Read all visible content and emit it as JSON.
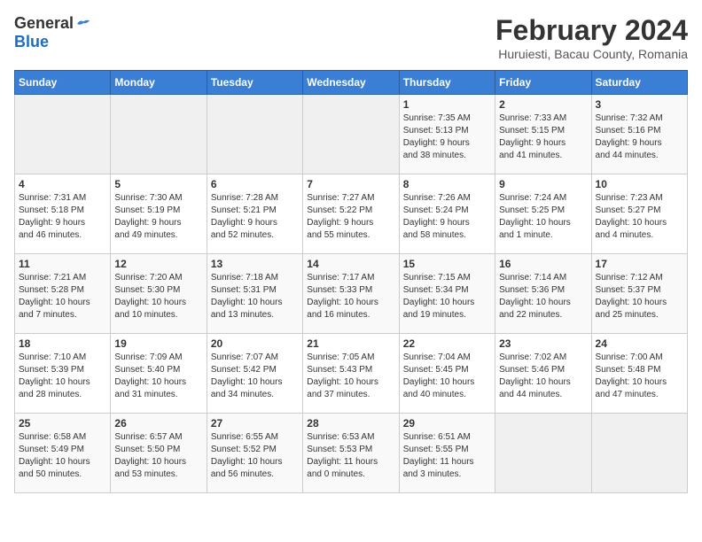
{
  "header": {
    "logo_general": "General",
    "logo_blue": "Blue",
    "title": "February 2024",
    "subtitle": "Huruiesti, Bacau County, Romania"
  },
  "weekdays": [
    "Sunday",
    "Monday",
    "Tuesday",
    "Wednesday",
    "Thursday",
    "Friday",
    "Saturday"
  ],
  "weeks": [
    [
      {
        "day": "",
        "info": ""
      },
      {
        "day": "",
        "info": ""
      },
      {
        "day": "",
        "info": ""
      },
      {
        "day": "",
        "info": ""
      },
      {
        "day": "1",
        "info": "Sunrise: 7:35 AM\nSunset: 5:13 PM\nDaylight: 9 hours\nand 38 minutes."
      },
      {
        "day": "2",
        "info": "Sunrise: 7:33 AM\nSunset: 5:15 PM\nDaylight: 9 hours\nand 41 minutes."
      },
      {
        "day": "3",
        "info": "Sunrise: 7:32 AM\nSunset: 5:16 PM\nDaylight: 9 hours\nand 44 minutes."
      }
    ],
    [
      {
        "day": "4",
        "info": "Sunrise: 7:31 AM\nSunset: 5:18 PM\nDaylight: 9 hours\nand 46 minutes."
      },
      {
        "day": "5",
        "info": "Sunrise: 7:30 AM\nSunset: 5:19 PM\nDaylight: 9 hours\nand 49 minutes."
      },
      {
        "day": "6",
        "info": "Sunrise: 7:28 AM\nSunset: 5:21 PM\nDaylight: 9 hours\nand 52 minutes."
      },
      {
        "day": "7",
        "info": "Sunrise: 7:27 AM\nSunset: 5:22 PM\nDaylight: 9 hours\nand 55 minutes."
      },
      {
        "day": "8",
        "info": "Sunrise: 7:26 AM\nSunset: 5:24 PM\nDaylight: 9 hours\nand 58 minutes."
      },
      {
        "day": "9",
        "info": "Sunrise: 7:24 AM\nSunset: 5:25 PM\nDaylight: 10 hours\nand 1 minute."
      },
      {
        "day": "10",
        "info": "Sunrise: 7:23 AM\nSunset: 5:27 PM\nDaylight: 10 hours\nand 4 minutes."
      }
    ],
    [
      {
        "day": "11",
        "info": "Sunrise: 7:21 AM\nSunset: 5:28 PM\nDaylight: 10 hours\nand 7 minutes."
      },
      {
        "day": "12",
        "info": "Sunrise: 7:20 AM\nSunset: 5:30 PM\nDaylight: 10 hours\nand 10 minutes."
      },
      {
        "day": "13",
        "info": "Sunrise: 7:18 AM\nSunset: 5:31 PM\nDaylight: 10 hours\nand 13 minutes."
      },
      {
        "day": "14",
        "info": "Sunrise: 7:17 AM\nSunset: 5:33 PM\nDaylight: 10 hours\nand 16 minutes."
      },
      {
        "day": "15",
        "info": "Sunrise: 7:15 AM\nSunset: 5:34 PM\nDaylight: 10 hours\nand 19 minutes."
      },
      {
        "day": "16",
        "info": "Sunrise: 7:14 AM\nSunset: 5:36 PM\nDaylight: 10 hours\nand 22 minutes."
      },
      {
        "day": "17",
        "info": "Sunrise: 7:12 AM\nSunset: 5:37 PM\nDaylight: 10 hours\nand 25 minutes."
      }
    ],
    [
      {
        "day": "18",
        "info": "Sunrise: 7:10 AM\nSunset: 5:39 PM\nDaylight: 10 hours\nand 28 minutes."
      },
      {
        "day": "19",
        "info": "Sunrise: 7:09 AM\nSunset: 5:40 PM\nDaylight: 10 hours\nand 31 minutes."
      },
      {
        "day": "20",
        "info": "Sunrise: 7:07 AM\nSunset: 5:42 PM\nDaylight: 10 hours\nand 34 minutes."
      },
      {
        "day": "21",
        "info": "Sunrise: 7:05 AM\nSunset: 5:43 PM\nDaylight: 10 hours\nand 37 minutes."
      },
      {
        "day": "22",
        "info": "Sunrise: 7:04 AM\nSunset: 5:45 PM\nDaylight: 10 hours\nand 40 minutes."
      },
      {
        "day": "23",
        "info": "Sunrise: 7:02 AM\nSunset: 5:46 PM\nDaylight: 10 hours\nand 44 minutes."
      },
      {
        "day": "24",
        "info": "Sunrise: 7:00 AM\nSunset: 5:48 PM\nDaylight: 10 hours\nand 47 minutes."
      }
    ],
    [
      {
        "day": "25",
        "info": "Sunrise: 6:58 AM\nSunset: 5:49 PM\nDaylight: 10 hours\nand 50 minutes."
      },
      {
        "day": "26",
        "info": "Sunrise: 6:57 AM\nSunset: 5:50 PM\nDaylight: 10 hours\nand 53 minutes."
      },
      {
        "day": "27",
        "info": "Sunrise: 6:55 AM\nSunset: 5:52 PM\nDaylight: 10 hours\nand 56 minutes."
      },
      {
        "day": "28",
        "info": "Sunrise: 6:53 AM\nSunset: 5:53 PM\nDaylight: 11 hours\nand 0 minutes."
      },
      {
        "day": "29",
        "info": "Sunrise: 6:51 AM\nSunset: 5:55 PM\nDaylight: 11 hours\nand 3 minutes."
      },
      {
        "day": "",
        "info": ""
      },
      {
        "day": "",
        "info": ""
      }
    ]
  ]
}
